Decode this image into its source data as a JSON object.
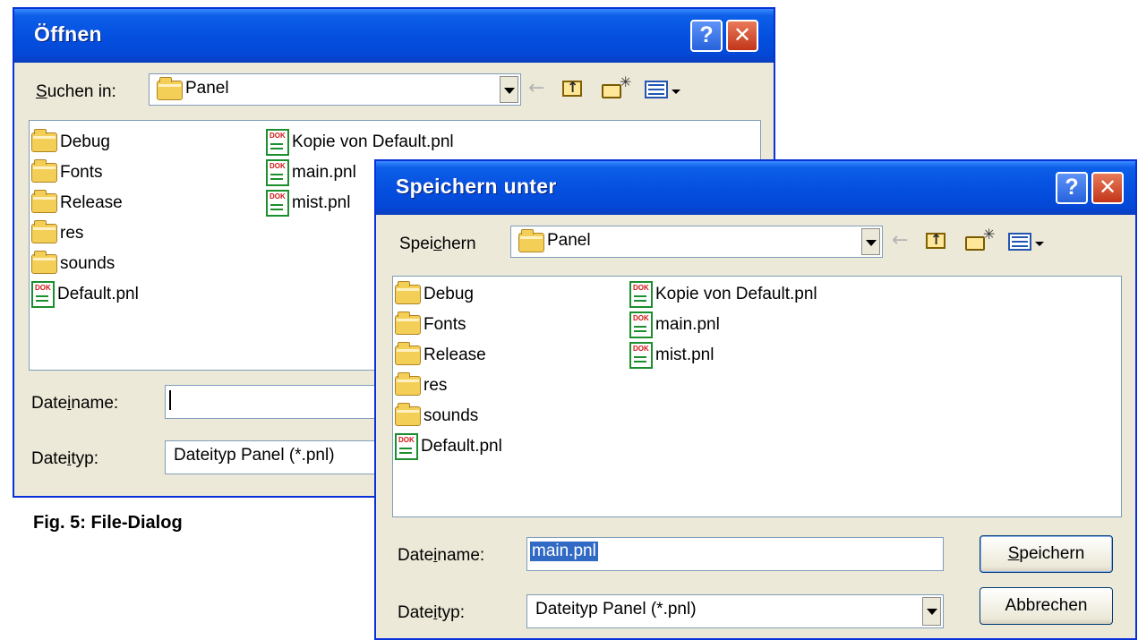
{
  "caption": "Fig. 5: File-Dialog",
  "open_dialog": {
    "title": "Öffnen",
    "help_label": "?",
    "close_label": "✕",
    "location_label": "Suchen in:",
    "location_value": "Panel",
    "folders": [
      "Debug",
      "Fonts",
      "Release",
      "res",
      "sounds"
    ],
    "files_col1": [
      "Default.pnl"
    ],
    "files_col2": [
      "Kopie von Default.pnl",
      "main.pnl",
      "mist.pnl"
    ],
    "filename_label": "Dateiname:",
    "filename_value": "",
    "filetype_label": "Dateityp:",
    "filetype_value": "Dateityp Panel (*.pnl)"
  },
  "save_dialog": {
    "title": "Speichern unter",
    "help_label": "?",
    "close_label": "✕",
    "location_label": "Speichern",
    "location_value": "Panel",
    "folders": [
      "Debug",
      "Fonts",
      "Release",
      "res",
      "sounds"
    ],
    "files_col1": [
      "Default.pnl"
    ],
    "files_col2": [
      "Kopie von Default.pnl",
      "main.pnl",
      "mist.pnl"
    ],
    "filename_label": "Dateiname:",
    "filename_value": "main.pnl",
    "filetype_label": "Dateityp:",
    "filetype_value": "Dateityp Panel (*.pnl)",
    "save_button": "Speichern",
    "cancel_button": "Abbrechen"
  },
  "icons": {
    "back": "back-arrow-icon",
    "up": "folder-up-icon",
    "new_folder": "new-folder-icon",
    "views": "view-menu-icon",
    "folder": "folder-icon",
    "file": "pnl-document-icon"
  },
  "colors": {
    "titlebar": "#0550e0",
    "dialog_bg": "#ece9d8",
    "selection": "#316ac5"
  }
}
